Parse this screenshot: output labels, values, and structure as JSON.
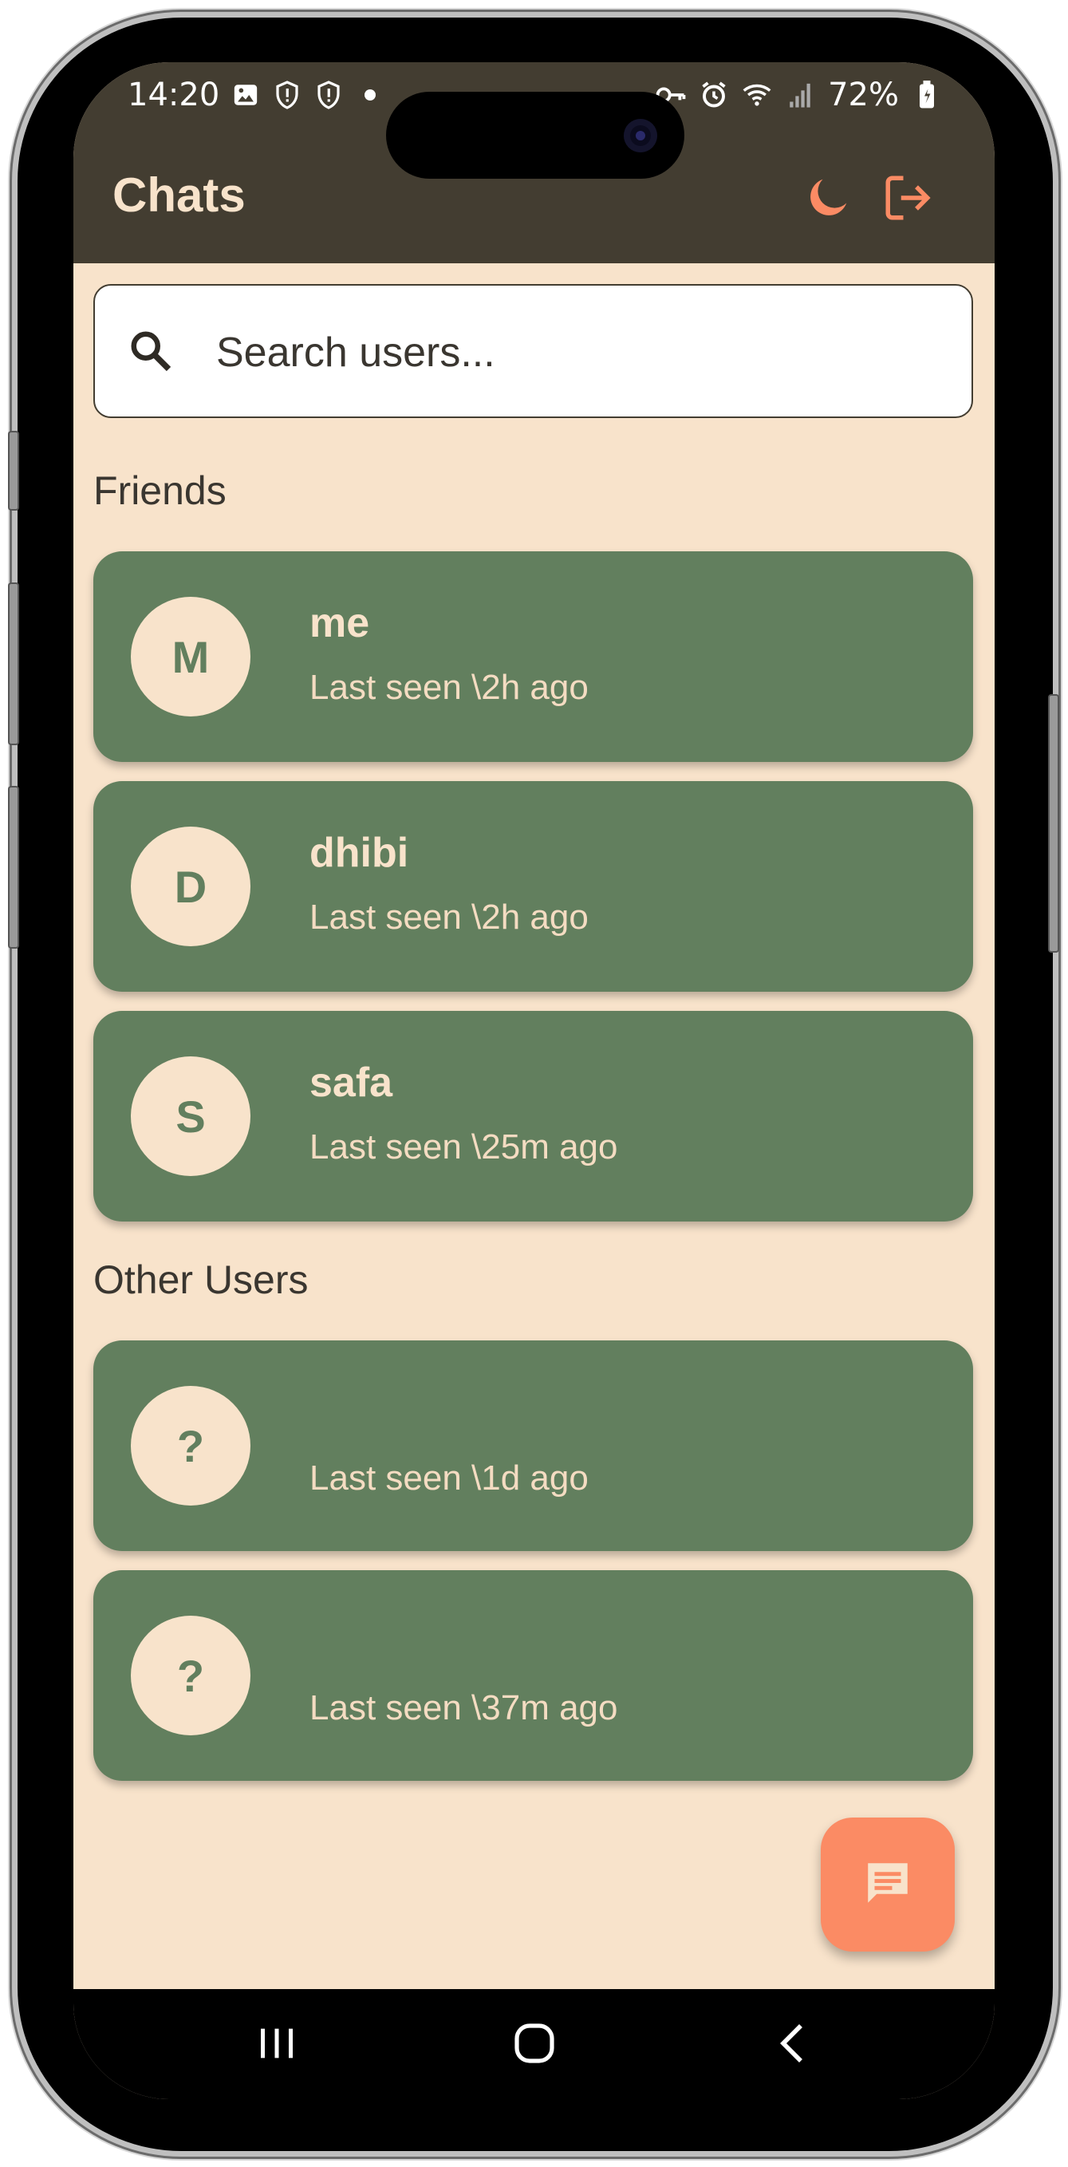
{
  "status_bar": {
    "time": "14:20",
    "battery": "72%",
    "icons_left": [
      "image-icon",
      "shield-icon",
      "shield-icon",
      "dot-icon"
    ],
    "icons_right": [
      "key-icon",
      "alarm-icon",
      "wifi-icon",
      "signal-icon",
      "battery-icon"
    ]
  },
  "header": {
    "title": "Chats",
    "theme_toggle_icon": "moon-icon",
    "logout_icon": "logout-icon"
  },
  "search": {
    "placeholder": "Search users..."
  },
  "friends": {
    "heading": "Friends",
    "items": [
      {
        "initial": "M",
        "name": "me",
        "last_seen": "Last seen \\2h ago"
      },
      {
        "initial": "D",
        "name": "dhibi",
        "last_seen": "Last seen \\2h ago"
      },
      {
        "initial": "S",
        "name": "safa",
        "last_seen": "Last seen \\25m ago"
      }
    ]
  },
  "other_users": {
    "heading": "Other Users",
    "items": [
      {
        "initial": "?",
        "name": "",
        "last_seen": "Last seen \\1d ago"
      },
      {
        "initial": "?",
        "name": "",
        "last_seen": "Last seen \\37m ago"
      }
    ]
  },
  "fab": {
    "icon": "chat-icon"
  },
  "colors": {
    "appbar": "#433d31",
    "background": "#f8e3cb",
    "card": "#627f5e",
    "accent": "#fb8b64"
  }
}
